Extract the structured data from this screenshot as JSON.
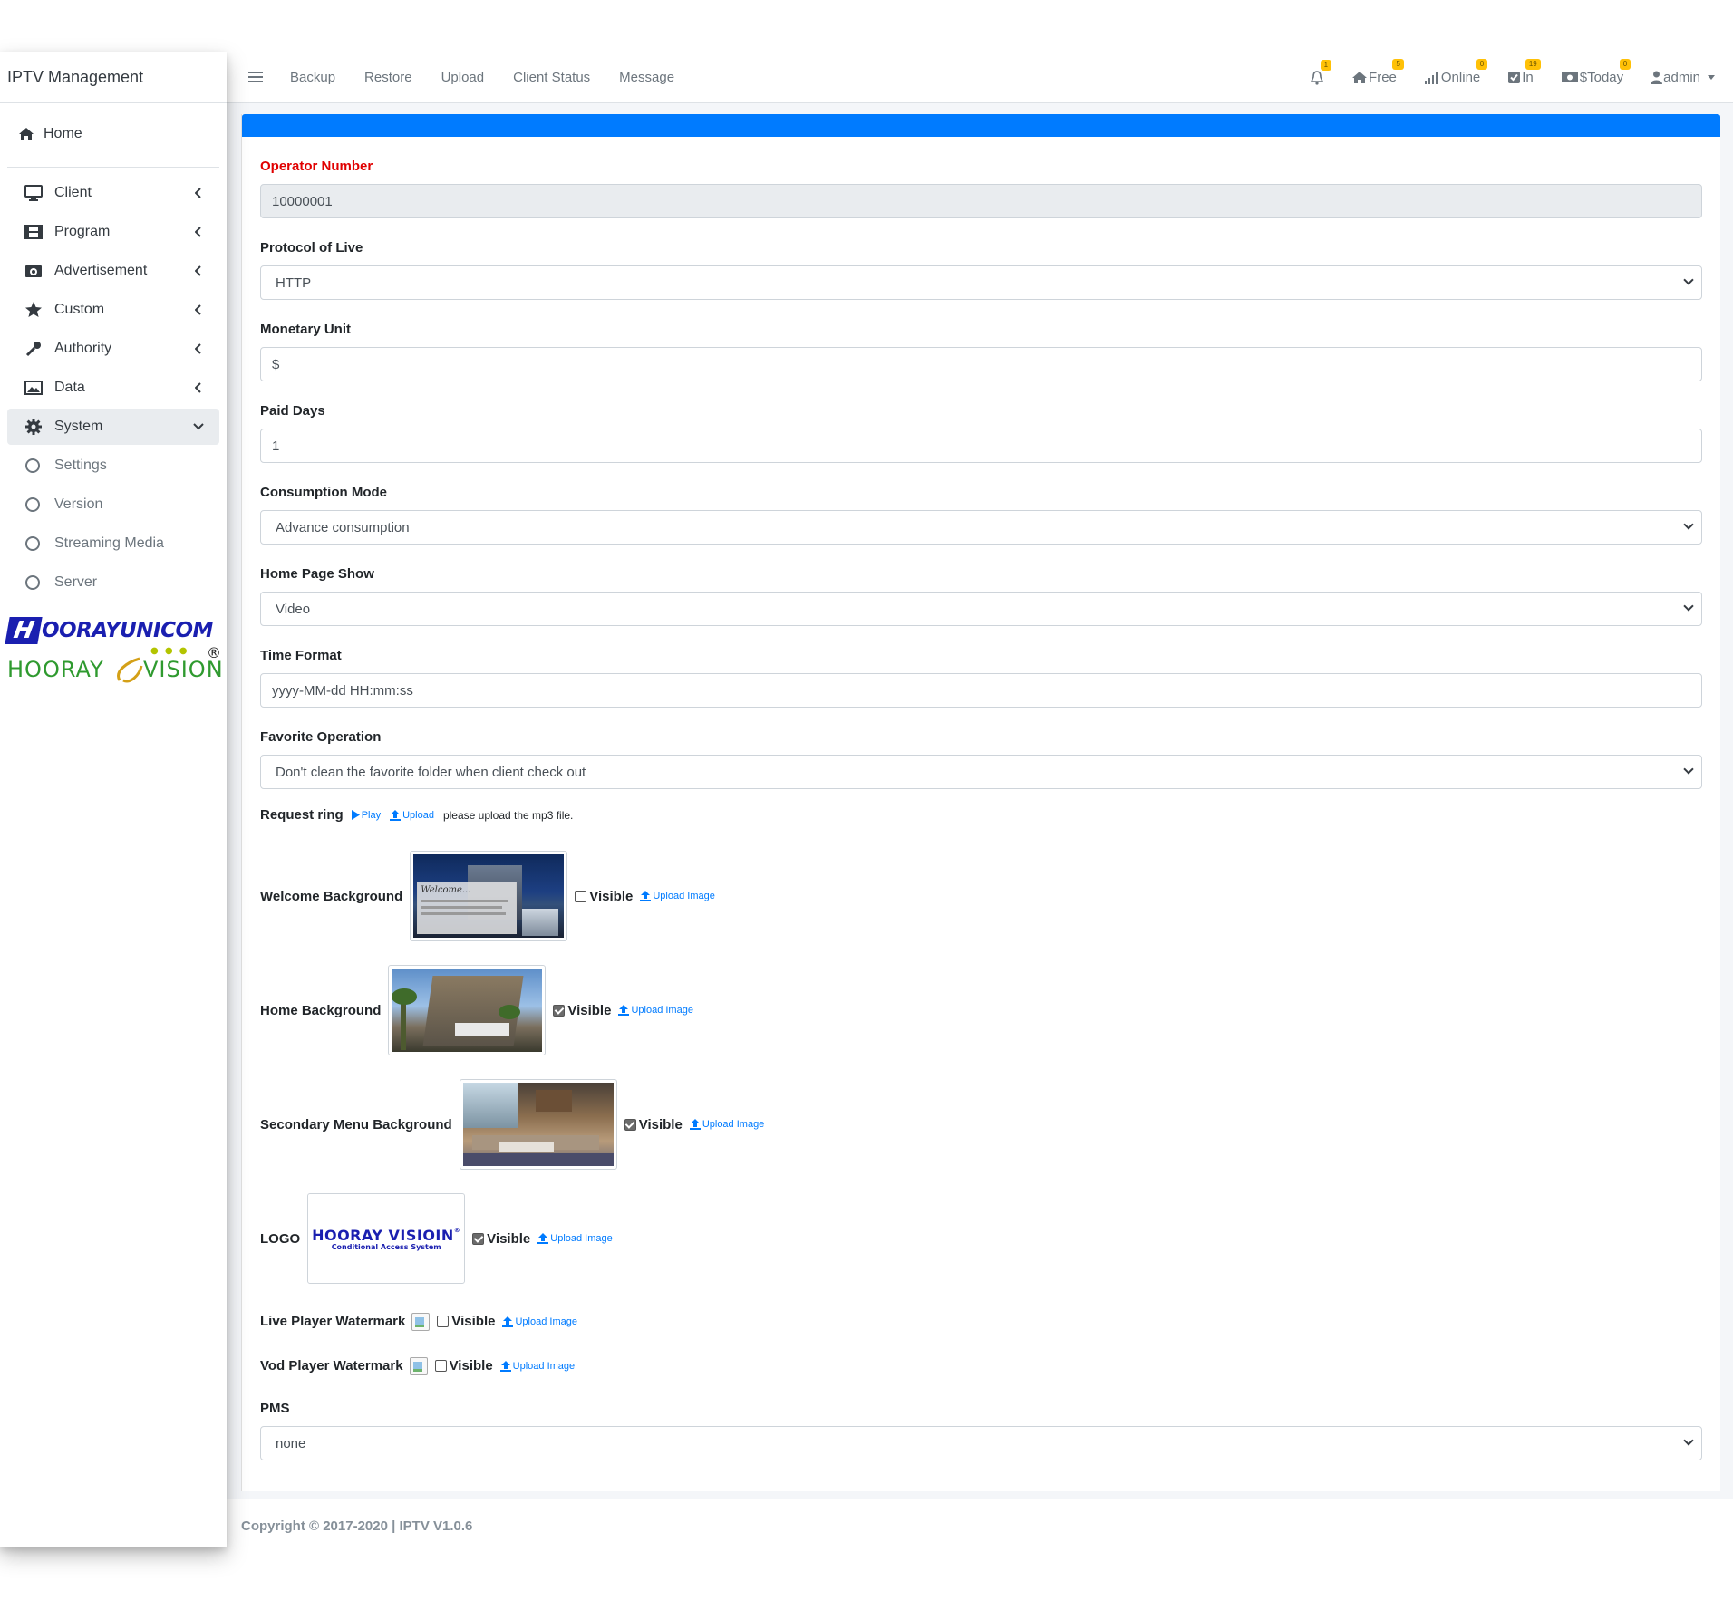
{
  "sidebar": {
    "brand": "IPTV Management",
    "home": "Home",
    "items": [
      {
        "label": "Client",
        "icon": "monitor-icon"
      },
      {
        "label": "Program",
        "icon": "film-icon"
      },
      {
        "label": "Advertisement",
        "icon": "camera-icon"
      },
      {
        "label": "Custom",
        "icon": "star-icon"
      },
      {
        "label": "Authority",
        "icon": "key-icon"
      },
      {
        "label": "Data",
        "icon": "image-icon"
      },
      {
        "label": "System",
        "icon": "gear-icon"
      }
    ],
    "subitems": [
      "Settings",
      "Version",
      "Streaming Media",
      "Server"
    ],
    "logo_top": "OORAYUNICOM",
    "logo_top_box": "H",
    "logo_bottom_left": "HOORAY",
    "logo_bottom_right": "VISION",
    "logo_reg": "®"
  },
  "topnav": {
    "links": [
      "Backup",
      "Restore",
      "Upload",
      "Client Status",
      "Message"
    ],
    "indicators": [
      {
        "label": "",
        "badge": "1",
        "icon": "bell-icon"
      },
      {
        "label": "Free",
        "badge": "5",
        "icon": "home-icon"
      },
      {
        "label": "Online",
        "badge": "0",
        "icon": "signal-icon"
      },
      {
        "label": "In",
        "badge": "19",
        "icon": "check-square-icon"
      },
      {
        "label": "$Today",
        "badge": "0",
        "icon": "money-icon"
      }
    ],
    "user": "admin"
  },
  "form": {
    "operator_label": "Operator Number",
    "operator_value": "10000001",
    "protocol_label": "Protocol of Live",
    "protocol_value": "HTTP",
    "monetary_label": "Monetary Unit",
    "monetary_value": "$",
    "paid_label": "Paid Days",
    "paid_value": "1",
    "consumption_label": "Consumption Mode",
    "consumption_value": "Advance consumption",
    "homeshow_label": "Home Page Show",
    "homeshow_value": "Video",
    "timefmt_label": "Time Format",
    "timefmt_value": "yyyy-MM-dd HH:mm:ss",
    "favorite_label": "Favorite Operation",
    "favorite_value": "Don't clean the favorite folder when client check out",
    "ring_label": "Request ring",
    "ring_play": "Play",
    "ring_upload": "Upload",
    "ring_hint": "please upload the mp3 file.",
    "images": [
      {
        "label": "Welcome Background",
        "visible": false,
        "visible_label": "Visible",
        "upload": "Upload Image",
        "overlay_text": "Welcome..."
      },
      {
        "label": "Home Background",
        "visible": true,
        "visible_label": "Visible",
        "upload": "Upload Image"
      },
      {
        "label": "Secondary Menu Background",
        "visible": true,
        "visible_label": "Visible",
        "upload": "Upload Image"
      },
      {
        "label": "LOGO",
        "visible": true,
        "visible_label": "Visible",
        "upload": "Upload Image",
        "logo_title": "HOORAY VISIOIN",
        "logo_sub": "Conditional Access System",
        "logo_reg": "®"
      }
    ],
    "watermarks": [
      {
        "label": "Live Player Watermark",
        "visible": false,
        "visible_label": "Visible",
        "upload": "Upload Image"
      },
      {
        "label": "Vod Player Watermark",
        "visible": false,
        "visible_label": "Visible",
        "upload": "Upload Image"
      }
    ],
    "pms_label": "PMS",
    "pms_value": "none"
  },
  "footer": {
    "text": "Copyright © 2017-2020 | IPTV V1.0.6"
  },
  "colors": {
    "primary": "#007bff",
    "required": "#e00000",
    "badge": "#ffc107",
    "success": "#28a745"
  }
}
